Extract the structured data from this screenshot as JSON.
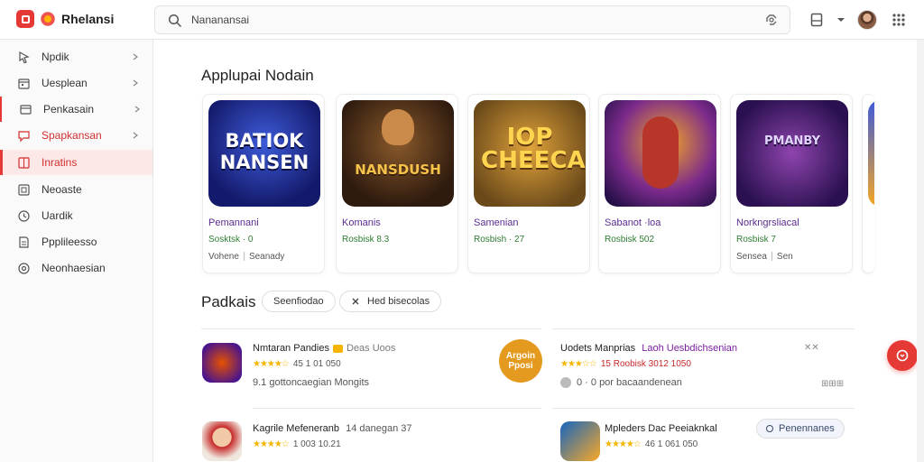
{
  "header": {
    "brand": "Rhelansi",
    "search_placeholder": "Nananansai",
    "colors": {
      "accent": "#e53935"
    }
  },
  "sidebar": {
    "items": [
      {
        "label": "Npdik",
        "icon": "cursor-icon",
        "chevron": true
      },
      {
        "label": "Uesplean",
        "icon": "calendar-icon",
        "chevron": true
      },
      {
        "label": "Penkasain",
        "icon": "window-icon",
        "chevron": true
      },
      {
        "label": "Spapkansan",
        "icon": "chat-icon",
        "chevron": true
      },
      {
        "label": "Inratins",
        "icon": "grid-icon",
        "chevron": false,
        "active": true
      },
      {
        "label": "Neoaste",
        "icon": "square-icon",
        "chevron": false
      },
      {
        "label": "Uardik",
        "icon": "clock-icon",
        "chevron": false
      },
      {
        "label": "Ppplileesso",
        "icon": "document-icon",
        "chevron": false
      },
      {
        "label": "Neonhaesian",
        "icon": "settings-icon",
        "chevron": false
      }
    ]
  },
  "featured": {
    "title": "Applupai Nodain",
    "cards": [
      {
        "art_text": "BATIOK NANSEN",
        "name": "Pemannani",
        "rating": "Sosktsk · 0",
        "meta_left": "Vohene",
        "meta_right": "Seanady"
      },
      {
        "art_text": "NANSDUSH",
        "name": "Komanis",
        "rating": "Rosbisk 8.3",
        "meta_left": "",
        "meta_right": ""
      },
      {
        "art_text": "IOP CHEECARS",
        "name": "Samenian",
        "rating": "Rosbish · 27",
        "meta_left": "",
        "meta_right": ""
      },
      {
        "art_text": "",
        "name": "Sabanot ·loa",
        "rating": "Rosbisk 502",
        "meta_left": "",
        "meta_right": ""
      },
      {
        "art_text": "PMANBY",
        "name": "Norkngrsliacal",
        "rating": "Rosbisk 7",
        "meta_left": "Sensea",
        "meta_right": "Sen"
      }
    ]
  },
  "products": {
    "title": "Padkais",
    "filters": [
      "Seenfiodao",
      "Hed bisecolas"
    ],
    "items": [
      {
        "title": "Nmtaran Pandies",
        "tag": "Deas Uoos",
        "rating": "45 1 01 050",
        "sub": "9.1 gottoncaegian Mongits",
        "side_text": ""
      },
      {
        "title": "Uodets Manprias",
        "tag": "Laoh Uesbdichsenian",
        "rating": "15 Roobisk 3012 1050",
        "sub": "0 · 0 por bacaandenean",
        "side_text": "",
        "badge_text": "Argoin Pposi"
      },
      {
        "title": "Kagrile Mefeneranb",
        "tag": "14 danegan 37",
        "rating": "1 003 10.21",
        "sub": "",
        "side_text": ""
      },
      {
        "title": "Mpleders Dac Peeiaknkal",
        "tag": "",
        "rating": "46 1 061 050",
        "sub": "",
        "side_text": "Penennanes"
      }
    ]
  }
}
